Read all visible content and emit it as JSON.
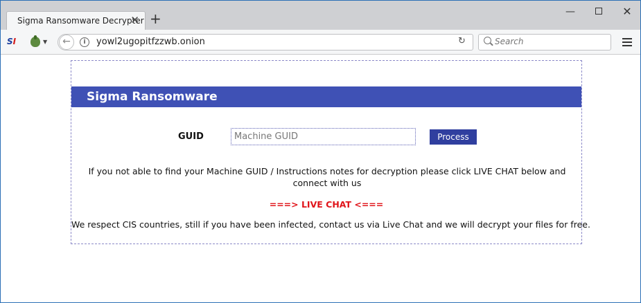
{
  "browser": {
    "tab_title": "Sigma Ransomware Decrypter",
    "tab_close_glyph": "✕",
    "new_tab_glyph": "+",
    "url": "yowl2ugopitfzzwb.onion",
    "search_placeholder": "Search",
    "back_glyph": "←",
    "reload_glyph": "↻",
    "info_glyph": "i",
    "site_logo": {
      "s": "S",
      "i": "I"
    },
    "window_controls": {
      "minimize": "—",
      "close": "✕"
    },
    "icons": [
      "back-arrow-icon",
      "info-icon",
      "reload-icon",
      "search-icon",
      "hamburger-menu-icon",
      "onion-icon"
    ]
  },
  "page": {
    "header_title": "Sigma Ransomware",
    "guid_label": "GUID",
    "guid_placeholder": "Machine GUID",
    "process_button": "Process",
    "info_text": "If you not able to find your Machine GUID / Instructions notes for decryption please click LIVE CHAT below and connect with us",
    "live_chat_link": "===> LIVE CHAT <===",
    "respect_text": "We respect CIS countries, still if you have been infected, contact us via Live Chat and we will decrypt your files for free."
  },
  "colors": {
    "header_bg": "#3f51b5",
    "button_bg": "#303f9f",
    "live_chat": "#e0141a",
    "window_border": "#2b6fb6"
  }
}
